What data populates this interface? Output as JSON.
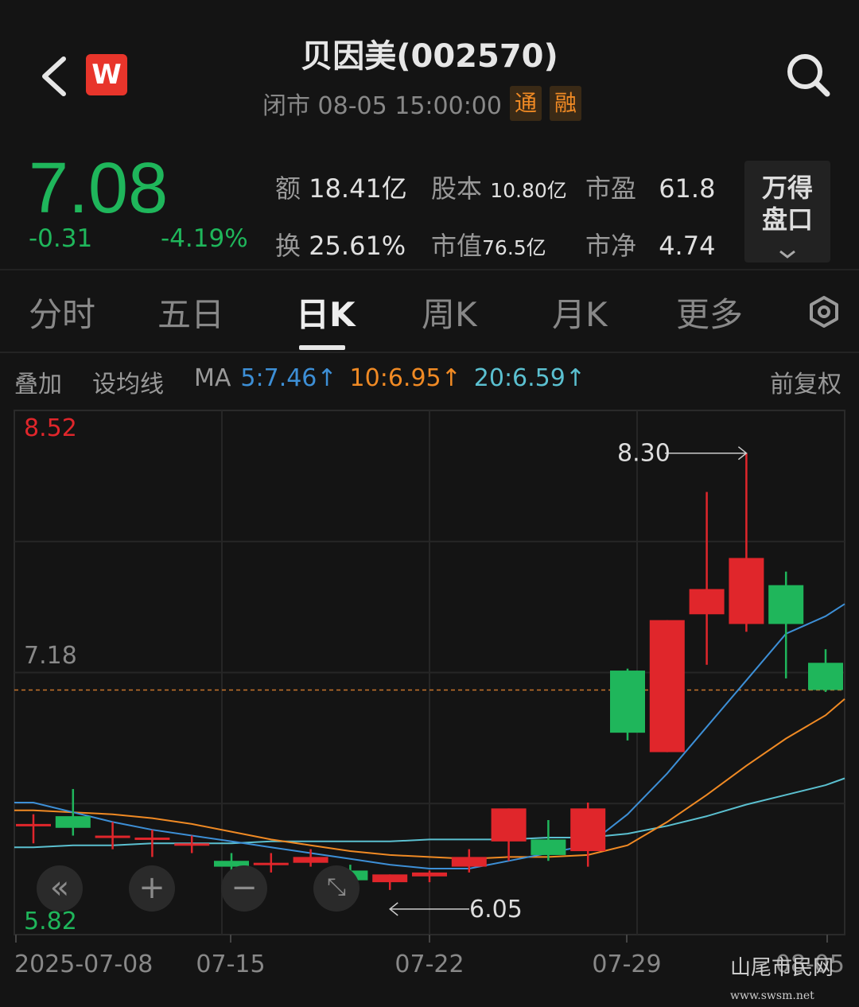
{
  "header": {
    "title": "贝因美(002570)",
    "status": "闭市 08-05 15:00:00",
    "tag_tong": "通",
    "tag_rong": "融",
    "logo_letter": "W"
  },
  "quote": {
    "price": "7.08",
    "change": "-0.31",
    "change_pct": "-4.19%",
    "amount_label": "额",
    "amount": "18.41亿",
    "capital_label": "股本",
    "capital": "10.80亿",
    "pe_label": "市盈",
    "pe": "61.8",
    "turnover_label": "换",
    "turnover": "25.61%",
    "mcap_label": "市值",
    "mcap": "76.5亿",
    "pb_label": "市净",
    "pb": "4.74",
    "wande_line1": "万得",
    "wande_line2": "盘口"
  },
  "tabs": [
    "分时",
    "五日",
    "日K",
    "周K",
    "月K",
    "更多"
  ],
  "ma_row": {
    "overlay": "叠加",
    "set_ma": "设均线",
    "ma": "MA",
    "ma5": "5:7.46↑",
    "ma10": "10:6.95↑",
    "ma20": "20:6.59↑",
    "adjust": "前复权"
  },
  "colors": {
    "up": "#e0262b",
    "down": "#1fb65b",
    "ma5": "#3d8fd6",
    "ma10": "#f08a24",
    "ma20": "#5bc0d0"
  },
  "chart_data": {
    "type": "candlestick",
    "y_max_label": "8.52",
    "y_mid_label": "7.18",
    "y_min_label": "5.82",
    "ylim": [
      5.82,
      8.52
    ],
    "last_close": 7.08,
    "high_annotation": "8.30",
    "low_annotation": "6.05",
    "x_labels": [
      "2025-07-08",
      "07-15",
      "07-22",
      "07-29",
      "08-05"
    ],
    "candles": [
      {
        "o": 6.39,
        "h": 6.44,
        "l": 6.29,
        "c": 6.39
      },
      {
        "o": 6.43,
        "h": 6.57,
        "l": 6.33,
        "c": 6.37
      },
      {
        "o": 6.33,
        "h": 6.4,
        "l": 6.26,
        "c": 6.33
      },
      {
        "o": 6.32,
        "h": 6.36,
        "l": 6.22,
        "c": 6.32
      },
      {
        "o": 6.29,
        "h": 6.33,
        "l": 6.24,
        "c": 6.29
      },
      {
        "o": 6.2,
        "h": 6.24,
        "l": 6.13,
        "c": 6.17
      },
      {
        "o": 6.19,
        "h": 6.24,
        "l": 6.14,
        "c": 6.19
      },
      {
        "o": 6.19,
        "h": 6.26,
        "l": 6.17,
        "c": 6.22
      },
      {
        "o": 6.15,
        "h": 6.18,
        "l": 6.06,
        "c": 6.1
      },
      {
        "o": 6.09,
        "h": 6.13,
        "l": 6.05,
        "c": 6.13
      },
      {
        "o": 6.12,
        "h": 6.15,
        "l": 6.09,
        "c": 6.14
      },
      {
        "o": 6.17,
        "h": 6.26,
        "l": 6.14,
        "c": 6.22
      },
      {
        "o": 6.3,
        "h": 6.47,
        "l": 6.2,
        "c": 6.47
      },
      {
        "o": 6.31,
        "h": 6.41,
        "l": 6.2,
        "c": 6.23
      },
      {
        "o": 6.25,
        "h": 6.5,
        "l": 6.17,
        "c": 6.47
      },
      {
        "o": 7.18,
        "h": 7.19,
        "l": 6.82,
        "c": 6.86
      },
      {
        "o": 6.76,
        "h": 7.44,
        "l": 6.76,
        "c": 7.44
      },
      {
        "o": 7.47,
        "h": 8.1,
        "l": 7.21,
        "c": 7.6
      },
      {
        "o": 7.42,
        "h": 8.3,
        "l": 7.38,
        "c": 7.76
      },
      {
        "o": 7.62,
        "h": 7.69,
        "l": 7.14,
        "c": 7.42
      },
      {
        "o": 7.22,
        "h": 7.29,
        "l": 7.07,
        "c": 7.08
      }
    ],
    "ma5": [
      6.5,
      6.45,
      6.4,
      6.36,
      6.33,
      6.3,
      6.27,
      6.24,
      6.21,
      6.18,
      6.16,
      6.16,
      6.2,
      6.24,
      6.28,
      6.44,
      6.65,
      6.89,
      7.13,
      7.37,
      7.46
    ],
    "ma10": [
      6.46,
      6.45,
      6.44,
      6.42,
      6.39,
      6.35,
      6.31,
      6.28,
      6.25,
      6.23,
      6.22,
      6.21,
      6.22,
      6.22,
      6.23,
      6.28,
      6.4,
      6.54,
      6.69,
      6.83,
      6.95
    ],
    "ma20": [
      6.27,
      6.28,
      6.28,
      6.29,
      6.29,
      6.29,
      6.3,
      6.3,
      6.3,
      6.3,
      6.31,
      6.31,
      6.31,
      6.32,
      6.32,
      6.34,
      6.38,
      6.43,
      6.49,
      6.54,
      6.59
    ]
  }
}
